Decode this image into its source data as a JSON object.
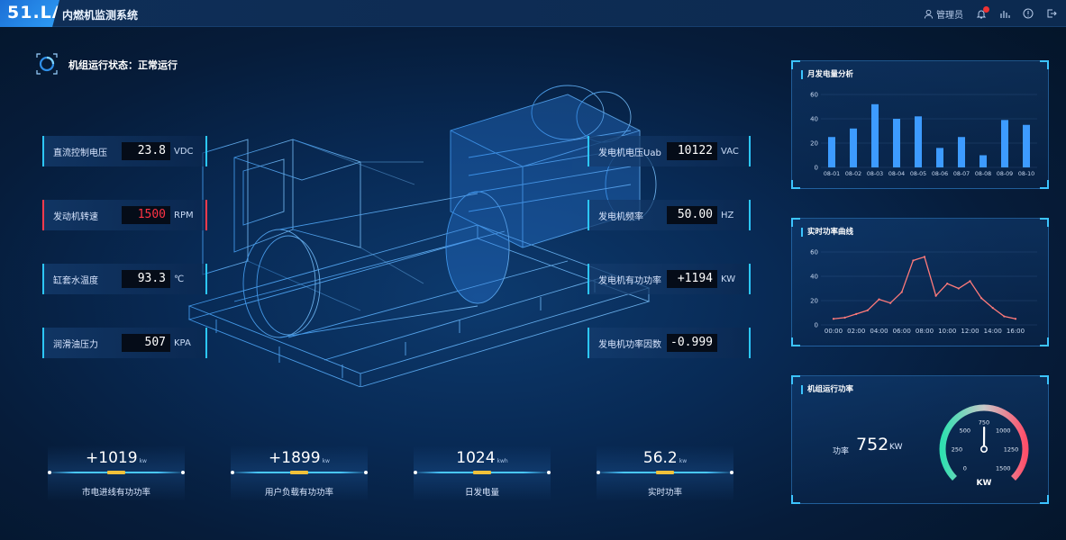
{
  "header": {
    "logo": "51.LA",
    "title": "内燃机监测系统",
    "user": "管理员"
  },
  "status": {
    "text": "机组运行状态：正常运行"
  },
  "left_readings": [
    {
      "label": "直流控制电压",
      "value": "23.8",
      "unit": "VDC",
      "alarm": false
    },
    {
      "label": "发动机转速",
      "value": "1500",
      "unit": "RPM",
      "alarm": true
    },
    {
      "label": "缸套水温度",
      "value": "93.3",
      "unit": "℃",
      "alarm": false
    },
    {
      "label": "润滑油压力",
      "value": "507",
      "unit": "KPA",
      "alarm": false
    }
  ],
  "right_readings": [
    {
      "label": "发电机电压Uab",
      "value": "10122",
      "unit": "VAC"
    },
    {
      "label": "发电机频率",
      "value": "50.00",
      "unit": "HZ"
    },
    {
      "label": "发电机有功功率",
      "value": "+1194",
      "unit": "KW"
    },
    {
      "label": "发电机功率因数",
      "value": "-0.999",
      "unit": ""
    }
  ],
  "bottom_stats": [
    {
      "value": "+1019",
      "unit": "kw",
      "label": "市电进线有功功率"
    },
    {
      "value": "+1899",
      "unit": "kw",
      "label": "用户负载有功功率"
    },
    {
      "value": "1024",
      "unit": "kwh",
      "label": "日发电量"
    },
    {
      "value": "56.2",
      "unit": "kw",
      "label": "实时功率"
    }
  ],
  "panels": {
    "monthly_title": "月发电量分析",
    "realtime_title": "实时功率曲线",
    "power_title": "机组运行功率",
    "power_label": "功率",
    "power_value": "752",
    "power_unit": "KW",
    "gauge_unit": "KW"
  },
  "chart_data": [
    {
      "type": "bar",
      "title": "月发电量分析",
      "categories": [
        "08-01",
        "08-02",
        "08-03",
        "08-04",
        "08-05",
        "08-06",
        "08-07",
        "08-08",
        "08-09",
        "08-10"
      ],
      "values": [
        25,
        32,
        52,
        40,
        42,
        16,
        25,
        10,
        39,
        35
      ],
      "ylim": [
        0,
        60
      ],
      "yticks": [
        0,
        20,
        40,
        60
      ],
      "color": "#3d9bff"
    },
    {
      "type": "line",
      "title": "实时功率曲线",
      "categories": [
        "00:00",
        "01:00",
        "02:00",
        "03:00",
        "04:00",
        "05:00",
        "06:00",
        "07:00",
        "08:00",
        "09:00",
        "10:00",
        "11:00",
        "12:00",
        "13:00",
        "14:00",
        "15:00",
        "16:00"
      ],
      "xticks": [
        "00:00",
        "02:00",
        "04:00",
        "06:00",
        "08:00",
        "10:00",
        "12:00",
        "14:00",
        "16:00"
      ],
      "values": [
        5,
        6,
        9,
        12,
        21,
        18,
        27,
        53,
        56,
        24,
        34,
        30,
        36,
        22,
        14,
        7,
        5
      ],
      "ylim": [
        0,
        60
      ],
      "yticks": [
        0,
        20,
        40,
        60
      ],
      "color": "#ff7a7a"
    },
    {
      "type": "gauge",
      "title": "机组运行功率",
      "value": 752,
      "range": [
        0,
        1500
      ],
      "ticks": [
        0,
        250,
        500,
        750,
        1000,
        1250,
        1500
      ],
      "unit": "KW"
    }
  ]
}
